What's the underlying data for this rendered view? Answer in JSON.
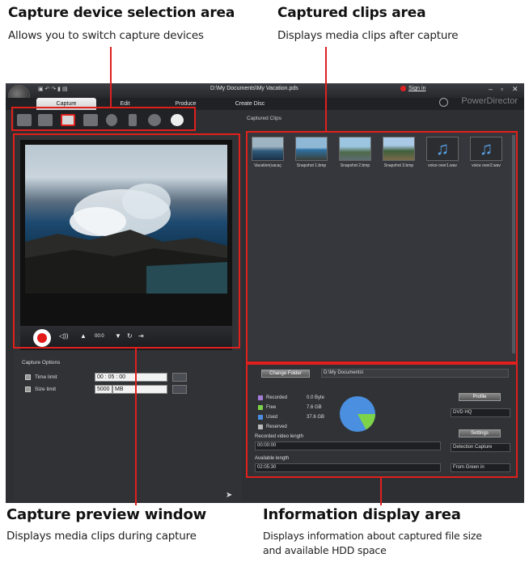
{
  "annotations": {
    "device": {
      "title": "Capture device selection area",
      "desc": "Allows you to switch capture devices"
    },
    "clips": {
      "title": "Captured clips area",
      "desc": "Displays media clips after capture"
    },
    "preview": {
      "title": "Capture preview window",
      "desc": "Displays media clips during capture"
    },
    "info": {
      "title": "Information display area",
      "desc1": "Displays information about captured file size",
      "desc2": "and available HDD space"
    }
  },
  "app": {
    "window_title": "D:\\My Documents\\My Vacation.pds",
    "sign_in": "Sign in",
    "brand": "PowerDirector",
    "tabs": [
      "Capture",
      "Edit",
      "Produce",
      "Create Disc"
    ]
  },
  "clips": {
    "header": "Captured Clips",
    "items": [
      {
        "label": "Vacation(vacaç",
        "kind": "video"
      },
      {
        "label": "Snapshot 1.bmp",
        "kind": "image"
      },
      {
        "label": "Snapshot 2.bmp",
        "kind": "image"
      },
      {
        "label": "Snapshot 3.bmp",
        "kind": "image"
      },
      {
        "label": "voice over1.wav",
        "kind": "audio"
      },
      {
        "label": "voice over2.wav",
        "kind": "audio"
      }
    ]
  },
  "preview": {
    "counter": "00:0"
  },
  "options": {
    "title": "Capture Options",
    "time_limit_label": "Time limit",
    "time_limit_value": "00 : 05 : 00",
    "size_limit_label": "Size limit",
    "size_limit_value": "5000",
    "size_unit": "MB"
  },
  "info": {
    "change_folder": "Change Folder",
    "folder_path": "D:\\My Documents\\",
    "legend": [
      {
        "label": "Recorded",
        "value": "0.0 Byte",
        "color": "#a67bd6"
      },
      {
        "label": "Free",
        "value": "7.6 GB",
        "color": "#7dd34a"
      },
      {
        "label": "Used",
        "value": "37.6 GB",
        "color": "#4a8fe0"
      },
      {
        "label": "Reserved",
        "value": "",
        "color": "#bbbbbb"
      }
    ],
    "recorded_length_label": "Recorded video length",
    "recorded_length_value": "00:00:00",
    "available_length_label": "Available length",
    "available_length_value": "02:05:30",
    "profile_btn": "Profile",
    "profile_value": "DVD HQ",
    "settings_btn": "Settings",
    "settings_value": "Detection Capture",
    "green_screen": "From Green in",
    "pie_free_fraction": 0.17
  }
}
